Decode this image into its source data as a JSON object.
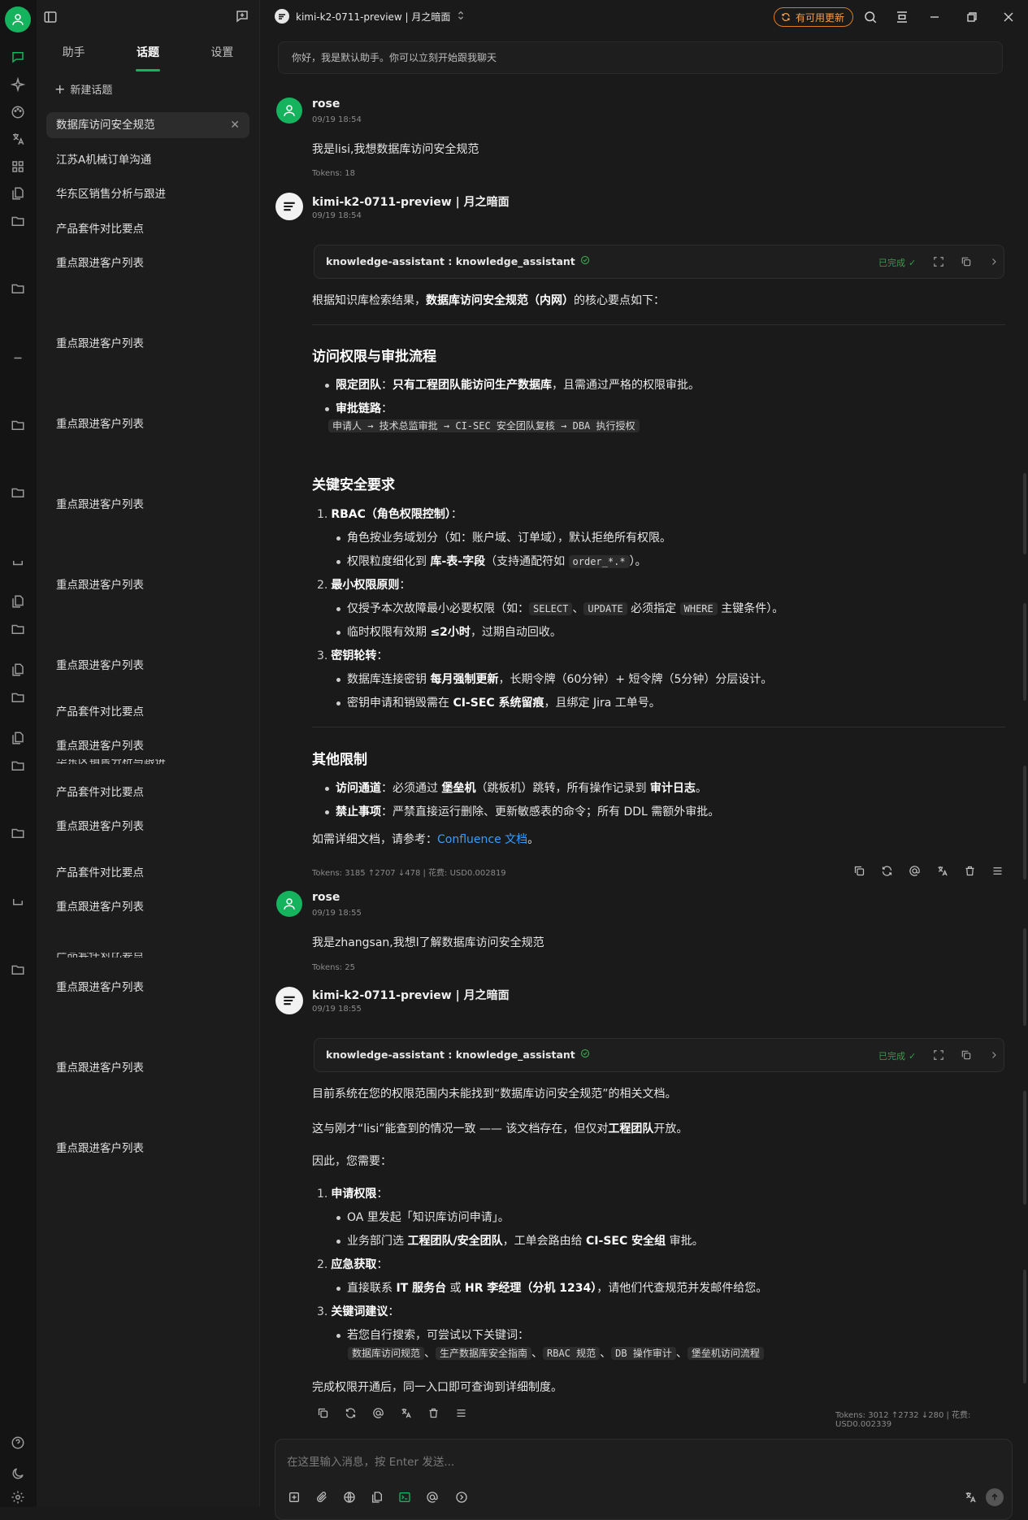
{
  "topbar": {
    "model_label": "kimi-k2-0711-preview | 月之暗面",
    "update_label": "有可用更新"
  },
  "sidebar": {
    "tabs": [
      "助手",
      "话题",
      "设置"
    ],
    "new_topic": "新建话题",
    "topics": [
      "数据库访问安全规范",
      "江苏A机械订单沟通",
      "华东区销售分析与跟进",
      "产品套件对比要点",
      "重点跟进客户列表",
      "重点跟进客户列表",
      "重点跟进客户列表",
      "重点跟进客户列表",
      "重点跟进客户列表",
      "重点跟进客户列表",
      "产品套件对比要点",
      "重点跟进客户列表",
      "产品套件对比要点",
      "重点跟进客户列表",
      "产品套件对比要点",
      "重点跟进客户列表",
      "重点跟进客户列表",
      "重点跟进客户列表",
      "重点跟进客户列表"
    ],
    "topics_clipped": [
      "华东区销售分析与跟进",
      "产品套件对比要点"
    ]
  },
  "welcome": "你好，我是默认助手。你可以立刻开始跟我聊天",
  "messages": {
    "m1": {
      "name": "rose",
      "time": "09/19 18:54",
      "text": "我是lisi,我想数据库访问安全规范",
      "tokens": "Tokens: 18"
    },
    "m2": {
      "name": "kimi-k2-0711-preview | 月之暗面",
      "time": "09/19 18:54",
      "tool_name": "knowledge-assistant : knowledge_assistant",
      "tool_status": "已完成",
      "intro_pre": "根据知识库检索结果，",
      "intro_bold": "数据库访问安全规范（内网）",
      "intro_post": "的核心要点如下：",
      "h1": "访问权限与审批流程",
      "b1_bold": "限定团队",
      "b1_colon": "：",
      "b1_bold2": "只有工程团队能访问生产数据库",
      "b1_rest": "，且需通过严格的权限审批。",
      "b2_bold": "审批链路",
      "b2_colon": "：",
      "b2_code": "申请人 → 技术总监审批 → CI-SEC 安全团队复核 → DBA 执行授权",
      "h2": "关键安全要求",
      "o1_num": "1.",
      "o1_title": "RBAC（角色权限控制）",
      "o1_colon": "：",
      "o1_s1": "角色按业务域划分（如：账户域、订单域），默认拒绝所有权限。",
      "o1_s2_pre": "权限粒度细化到 ",
      "o1_s2_bold": "库-表-字段",
      "o1_s2_mid": "（支持通配符如 ",
      "o1_s2_code": "order_*.*",
      "o1_s2_post": "）。",
      "o2_num": "2.",
      "o2_title": "最小权限原则",
      "o2_colon": "：",
      "o2_s1_pre": "仅授予本次故障最小必要权限（如：",
      "o2_s1_code1": "SELECT",
      "o2_s1_sep": "、",
      "o2_s1_code2": "UPDATE",
      "o2_s1_mid": " 必须指定 ",
      "o2_s1_code3": "WHERE",
      "o2_s1_post": " 主键条件）。",
      "o2_s2_pre": "临时权限有效期 ",
      "o2_s2_bold": "≤2小时",
      "o2_s2_post": "，过期自动回收。",
      "o3_num": "3.",
      "o3_title": "密钥轮转",
      "o3_colon": "：",
      "o3_s1_pre": "数据库连接密钥 ",
      "o3_s1_bold": "每月强制更新",
      "o3_s1_post": "，长期令牌（60分钟）+ 短令牌（5分钟）分层设计。",
      "o3_s2_pre": "密钥申请和销毁需在 ",
      "o3_s2_bold": "CI-SEC 系统留痕",
      "o3_s2_post": "，且绑定 Jira 工单号。",
      "h3": "其他限制",
      "c1_bold": "访问通道",
      "c1_mid": "：必须通过 ",
      "c1_bold2": "堡垒机",
      "c1_mid2": "（跳板机）跳转，所有操作记录到 ",
      "c1_bold3": "审计日志",
      "c1_post": "。",
      "c2_bold": "禁止事项",
      "c2_rest": "：严禁直接运行删除、更新敏感表的命令；所有 DDL 需额外审批。",
      "ref_pre": "如需详细文档，请参考：",
      "ref_link": "Confluence 文档",
      "ref_post": "。",
      "tokens": "Tokens: 3185 ↑2707 ↓478 | 花费: USD0.002819"
    },
    "m3": {
      "name": "rose",
      "time": "09/19 18:55",
      "text": "我是zhangsan,我想l了解数据库访问安全规范",
      "tokens": "Tokens: 25"
    },
    "m4": {
      "name": "kimi-k2-0711-preview | 月之暗面",
      "time": "09/19 18:55",
      "tool_name": "knowledge-assistant : knowledge_assistant",
      "tool_status": "已完成",
      "p1": "目前系统在您的权限范围内未能找到“数据库访问安全规范”的相关文档。",
      "p2_pre": "这与刚才“lisi”能查到的情况一致 —— 该文档存在，但仅对",
      "p2_bold": "工程团队",
      "p2_post": "开放。",
      "p3": "因此，您需要：",
      "o1_num": "1.",
      "o1_title": "申请权限",
      "o1_colon": "：",
      "o1_s1": "OA 里发起「知识库访问申请」。",
      "o1_s2_pre": "业务部门选 ",
      "o1_s2_bold": "工程团队/安全团队",
      "o1_s2_mid": "，工单会路由给 ",
      "o1_s2_bold2": "CI-SEC 安全组",
      "o1_s2_post": " 审批。",
      "o2_num": "2.",
      "o2_title": "应急获取",
      "o2_colon": "：",
      "o2_s1_pre": "直接联系 ",
      "o2_s1_bold": "IT 服务台",
      "o2_s1_mid": " 或 ",
      "o2_s1_bold2": "HR 李经理（分机 1234）",
      "o2_s1_post": "，请他们代查规范并发邮件给您。",
      "o3_num": "3.",
      "o3_title": "关键词建议",
      "o3_colon": "：",
      "o3_s1": "若您自行搜索，可尝试以下关键词：",
      "kw": [
        "数据库访问规范",
        "生产数据库安全指南",
        "RBAC 规范",
        "DB 操作审计",
        "堡垒机访问流程"
      ],
      "kw_sep": "、",
      "closing": "完成权限开通后，同一入口即可查询到详细制度。",
      "tokens": "Tokens: 3012 ↑2732 ↓280 | 花费: USD0.002339"
    }
  },
  "input": {
    "placeholder": "在这里输入消息，按 Enter 发送..."
  },
  "colors": {
    "accent": "#16b35f",
    "update": "#e07b1d",
    "link": "#3b9cff",
    "status_done": "#3a9a4a"
  }
}
